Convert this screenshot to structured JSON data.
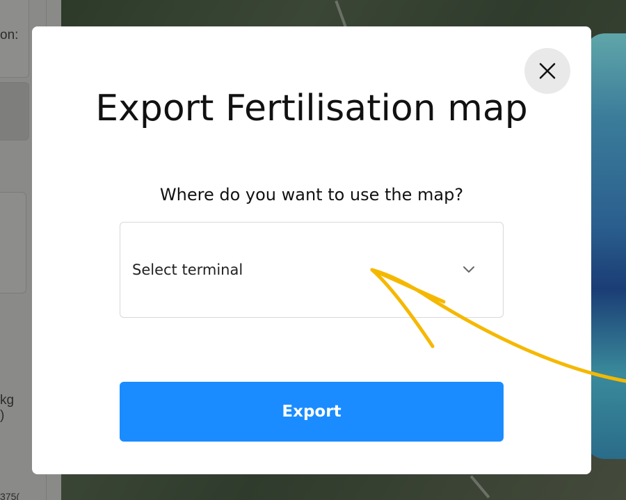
{
  "background": {
    "left_panel": {
      "text_top": "on:",
      "text_unit_line1": "kg",
      "text_unit_line2": ")",
      "text_bottom": "375("
    }
  },
  "modal": {
    "title": "Export Fertilisation map",
    "subtitle": "Where do you want to use the map?",
    "select": {
      "value": "Select terminal",
      "chevron_icon": "chevron-down-icon"
    },
    "export_label": "Export",
    "close_icon": "close-icon"
  },
  "colors": {
    "primary": "#1a8cff",
    "annotation_arrow": "#f5b800",
    "close_bg": "#e9e9e9"
  }
}
